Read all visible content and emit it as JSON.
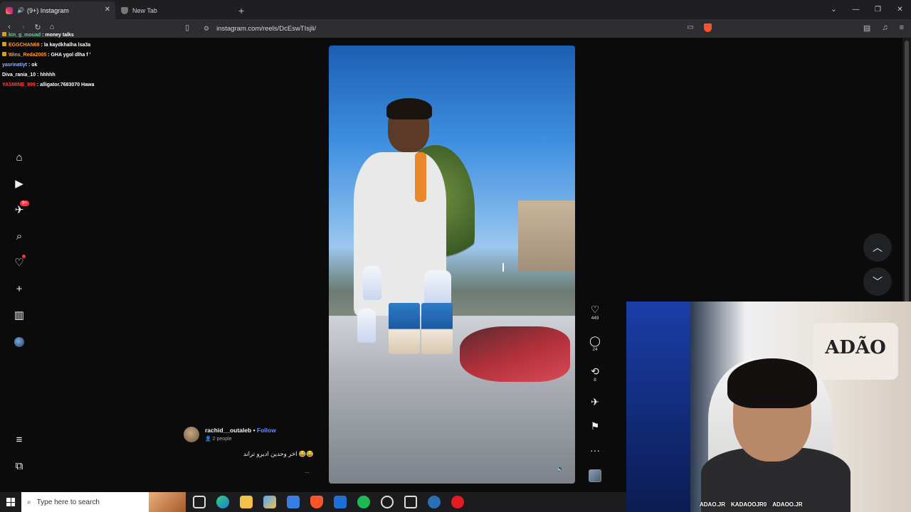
{
  "browser": {
    "tabs": [
      {
        "label": "(9+) Instagram",
        "active": true
      },
      {
        "label": "New Tab",
        "active": false
      }
    ],
    "url": "instagram.com/reels/DcEswTIsjli/"
  },
  "chat": [
    {
      "user": "kin_g_mouad",
      "text": "money talks",
      "color": "#5fd38d"
    },
    {
      "user": "EGGCHAN68",
      "text": "la kaydkhalha lsa3a",
      "color": "#ff9d2e"
    },
    {
      "user": "Wins_Reda2005",
      "text": "GHA ygol dlha f '",
      "color": "#ff9d2e"
    },
    {
      "user": "yasrinatiyt",
      "text": "ok",
      "color": "#8fb4ff"
    },
    {
      "user": "Diva_rania_10",
      "text": "hhhhh",
      "color": "#ffffff"
    },
    {
      "user": "YASMINE_999",
      "text": "alligator.7683070 Hawa",
      "color": "#ff4040"
    }
  ],
  "sidebar": {
    "messages_badge": "9+"
  },
  "reel": {
    "likes": "449",
    "comments": "24",
    "reposts": "8",
    "author": "rachid__outaleb",
    "follow": "Follow",
    "people": "2 people",
    "caption": "اخر وحدين اديرو تراند 😂😂",
    "more": "..."
  },
  "webcam": {
    "sign": "ADÃO",
    "socials": [
      "ADAO.JR",
      "KADAOOJR0",
      "ADAOO.JR"
    ]
  },
  "taskbar": {
    "search_placeholder": "Type here to search"
  }
}
